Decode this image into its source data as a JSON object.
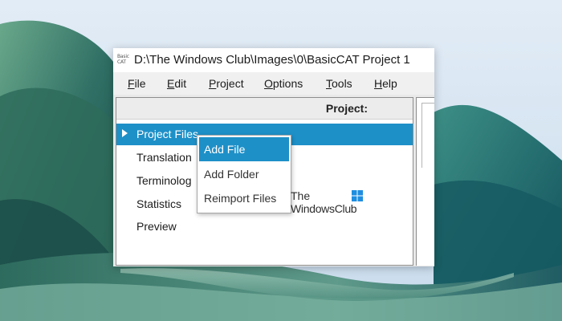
{
  "window": {
    "icon_text_line1": "Basic",
    "icon_text_line2": "CAT",
    "title": "D:\\The Windows Club\\Images\\0\\BasicCAT Project 1"
  },
  "menu": {
    "items": [
      {
        "mnemonic": "F",
        "rest": "ile"
      },
      {
        "mnemonic": "E",
        "rest": "dit"
      },
      {
        "mnemonic": "P",
        "rest": "roject"
      },
      {
        "mnemonic": "O",
        "rest": "ptions"
      },
      {
        "mnemonic": "T",
        "rest": "ools"
      },
      {
        "mnemonic": "H",
        "rest": "elp"
      }
    ]
  },
  "project_panel": {
    "header": "Project:",
    "tree": [
      {
        "label": "Project Files",
        "selected": true,
        "expandable": true
      },
      {
        "label": "Translation",
        "selected": false
      },
      {
        "label": "Terminolog",
        "selected": false
      },
      {
        "label": "Statistics",
        "selected": false
      },
      {
        "label": "Preview",
        "selected": false
      }
    ]
  },
  "context_menu": {
    "items": [
      {
        "label": "Add File",
        "highlighted": true
      },
      {
        "label": "Add Folder",
        "highlighted": false
      },
      {
        "label": "Reimport Files",
        "highlighted": false
      }
    ]
  },
  "watermark": {
    "line1": "The",
    "line2": "WindowsClub",
    "logo_icon": "windows-logo-icon"
  },
  "colors": {
    "selection": "#1e90c8",
    "menu_bar": "#f0f0f0",
    "panel_header": "#ececec",
    "wallpaper_sky": "#dbe6f2",
    "wallpaper_green": "#3f8a78"
  }
}
